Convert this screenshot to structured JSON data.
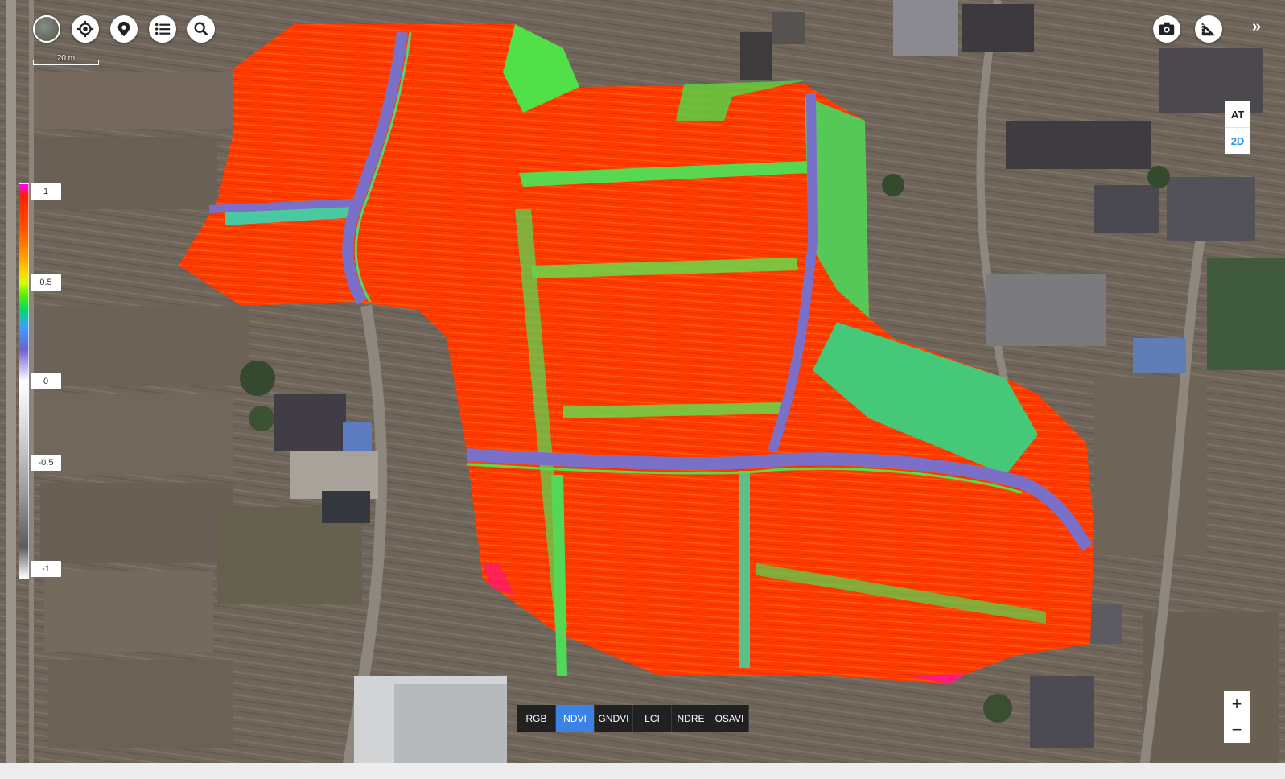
{
  "toolbar": {
    "buttons": [
      {
        "name": "layer-thumbnail-button",
        "icon": "map-thumbnail-icon"
      },
      {
        "name": "locate-button",
        "icon": "crosshair-icon"
      },
      {
        "name": "marker-button",
        "icon": "map-pin-icon"
      },
      {
        "name": "list-button",
        "icon": "list-icon"
      },
      {
        "name": "search-button",
        "icon": "search-icon"
      }
    ],
    "right_buttons": [
      {
        "name": "screenshot-button",
        "icon": "camera-icon"
      },
      {
        "name": "measure-button",
        "icon": "ruler-triangle-icon"
      }
    ],
    "collapse": "»"
  },
  "scale": {
    "label": "20 m"
  },
  "legend": {
    "labels": [
      "1",
      "0.5",
      "0",
      "-0.5",
      "-1"
    ]
  },
  "view_mode": {
    "at": "AT",
    "two_d": "2D"
  },
  "zoom": {
    "in": "+",
    "out": "−"
  },
  "index_bar": {
    "items": [
      "RGB",
      "NDVI",
      "GNDVI",
      "LCI",
      "NDRE",
      "OSAVI"
    ],
    "active": "NDVI"
  },
  "colors": {
    "accent": "#3b82e6",
    "mode_active": "#2a96e6",
    "ndvi_high": "#ff3a00",
    "ndvi_mid": "#52e048",
    "ndvi_low": "#7a70c8"
  }
}
